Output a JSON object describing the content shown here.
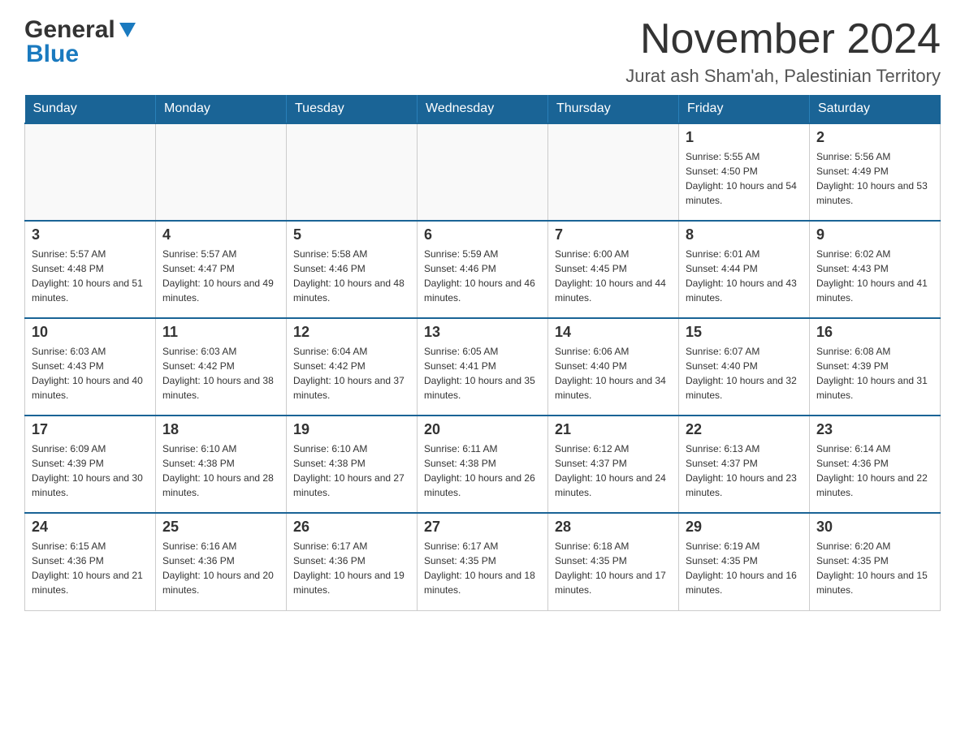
{
  "header": {
    "logo_general": "General",
    "logo_blue": "Blue",
    "month_title": "November 2024",
    "location": "Jurat ash Sham'ah, Palestinian Territory"
  },
  "weekdays": [
    "Sunday",
    "Monday",
    "Tuesday",
    "Wednesday",
    "Thursday",
    "Friday",
    "Saturday"
  ],
  "weeks": [
    {
      "days": [
        {
          "number": "",
          "sunrise": "",
          "sunset": "",
          "daylight": ""
        },
        {
          "number": "",
          "sunrise": "",
          "sunset": "",
          "daylight": ""
        },
        {
          "number": "",
          "sunrise": "",
          "sunset": "",
          "daylight": ""
        },
        {
          "number": "",
          "sunrise": "",
          "sunset": "",
          "daylight": ""
        },
        {
          "number": "",
          "sunrise": "",
          "sunset": "",
          "daylight": ""
        },
        {
          "number": "1",
          "sunrise": "Sunrise: 5:55 AM",
          "sunset": "Sunset: 4:50 PM",
          "daylight": "Daylight: 10 hours and 54 minutes."
        },
        {
          "number": "2",
          "sunrise": "Sunrise: 5:56 AM",
          "sunset": "Sunset: 4:49 PM",
          "daylight": "Daylight: 10 hours and 53 minutes."
        }
      ]
    },
    {
      "days": [
        {
          "number": "3",
          "sunrise": "Sunrise: 5:57 AM",
          "sunset": "Sunset: 4:48 PM",
          "daylight": "Daylight: 10 hours and 51 minutes."
        },
        {
          "number": "4",
          "sunrise": "Sunrise: 5:57 AM",
          "sunset": "Sunset: 4:47 PM",
          "daylight": "Daylight: 10 hours and 49 minutes."
        },
        {
          "number": "5",
          "sunrise": "Sunrise: 5:58 AM",
          "sunset": "Sunset: 4:46 PM",
          "daylight": "Daylight: 10 hours and 48 minutes."
        },
        {
          "number": "6",
          "sunrise": "Sunrise: 5:59 AM",
          "sunset": "Sunset: 4:46 PM",
          "daylight": "Daylight: 10 hours and 46 minutes."
        },
        {
          "number": "7",
          "sunrise": "Sunrise: 6:00 AM",
          "sunset": "Sunset: 4:45 PM",
          "daylight": "Daylight: 10 hours and 44 minutes."
        },
        {
          "number": "8",
          "sunrise": "Sunrise: 6:01 AM",
          "sunset": "Sunset: 4:44 PM",
          "daylight": "Daylight: 10 hours and 43 minutes."
        },
        {
          "number": "9",
          "sunrise": "Sunrise: 6:02 AM",
          "sunset": "Sunset: 4:43 PM",
          "daylight": "Daylight: 10 hours and 41 minutes."
        }
      ]
    },
    {
      "days": [
        {
          "number": "10",
          "sunrise": "Sunrise: 6:03 AM",
          "sunset": "Sunset: 4:43 PM",
          "daylight": "Daylight: 10 hours and 40 minutes."
        },
        {
          "number": "11",
          "sunrise": "Sunrise: 6:03 AM",
          "sunset": "Sunset: 4:42 PM",
          "daylight": "Daylight: 10 hours and 38 minutes."
        },
        {
          "number": "12",
          "sunrise": "Sunrise: 6:04 AM",
          "sunset": "Sunset: 4:42 PM",
          "daylight": "Daylight: 10 hours and 37 minutes."
        },
        {
          "number": "13",
          "sunrise": "Sunrise: 6:05 AM",
          "sunset": "Sunset: 4:41 PM",
          "daylight": "Daylight: 10 hours and 35 minutes."
        },
        {
          "number": "14",
          "sunrise": "Sunrise: 6:06 AM",
          "sunset": "Sunset: 4:40 PM",
          "daylight": "Daylight: 10 hours and 34 minutes."
        },
        {
          "number": "15",
          "sunrise": "Sunrise: 6:07 AM",
          "sunset": "Sunset: 4:40 PM",
          "daylight": "Daylight: 10 hours and 32 minutes."
        },
        {
          "number": "16",
          "sunrise": "Sunrise: 6:08 AM",
          "sunset": "Sunset: 4:39 PM",
          "daylight": "Daylight: 10 hours and 31 minutes."
        }
      ]
    },
    {
      "days": [
        {
          "number": "17",
          "sunrise": "Sunrise: 6:09 AM",
          "sunset": "Sunset: 4:39 PM",
          "daylight": "Daylight: 10 hours and 30 minutes."
        },
        {
          "number": "18",
          "sunrise": "Sunrise: 6:10 AM",
          "sunset": "Sunset: 4:38 PM",
          "daylight": "Daylight: 10 hours and 28 minutes."
        },
        {
          "number": "19",
          "sunrise": "Sunrise: 6:10 AM",
          "sunset": "Sunset: 4:38 PM",
          "daylight": "Daylight: 10 hours and 27 minutes."
        },
        {
          "number": "20",
          "sunrise": "Sunrise: 6:11 AM",
          "sunset": "Sunset: 4:38 PM",
          "daylight": "Daylight: 10 hours and 26 minutes."
        },
        {
          "number": "21",
          "sunrise": "Sunrise: 6:12 AM",
          "sunset": "Sunset: 4:37 PM",
          "daylight": "Daylight: 10 hours and 24 minutes."
        },
        {
          "number": "22",
          "sunrise": "Sunrise: 6:13 AM",
          "sunset": "Sunset: 4:37 PM",
          "daylight": "Daylight: 10 hours and 23 minutes."
        },
        {
          "number": "23",
          "sunrise": "Sunrise: 6:14 AM",
          "sunset": "Sunset: 4:36 PM",
          "daylight": "Daylight: 10 hours and 22 minutes."
        }
      ]
    },
    {
      "days": [
        {
          "number": "24",
          "sunrise": "Sunrise: 6:15 AM",
          "sunset": "Sunset: 4:36 PM",
          "daylight": "Daylight: 10 hours and 21 minutes."
        },
        {
          "number": "25",
          "sunrise": "Sunrise: 6:16 AM",
          "sunset": "Sunset: 4:36 PM",
          "daylight": "Daylight: 10 hours and 20 minutes."
        },
        {
          "number": "26",
          "sunrise": "Sunrise: 6:17 AM",
          "sunset": "Sunset: 4:36 PM",
          "daylight": "Daylight: 10 hours and 19 minutes."
        },
        {
          "number": "27",
          "sunrise": "Sunrise: 6:17 AM",
          "sunset": "Sunset: 4:35 PM",
          "daylight": "Daylight: 10 hours and 18 minutes."
        },
        {
          "number": "28",
          "sunrise": "Sunrise: 6:18 AM",
          "sunset": "Sunset: 4:35 PM",
          "daylight": "Daylight: 10 hours and 17 minutes."
        },
        {
          "number": "29",
          "sunrise": "Sunrise: 6:19 AM",
          "sunset": "Sunset: 4:35 PM",
          "daylight": "Daylight: 10 hours and 16 minutes."
        },
        {
          "number": "30",
          "sunrise": "Sunrise: 6:20 AM",
          "sunset": "Sunset: 4:35 PM",
          "daylight": "Daylight: 10 hours and 15 minutes."
        }
      ]
    }
  ]
}
